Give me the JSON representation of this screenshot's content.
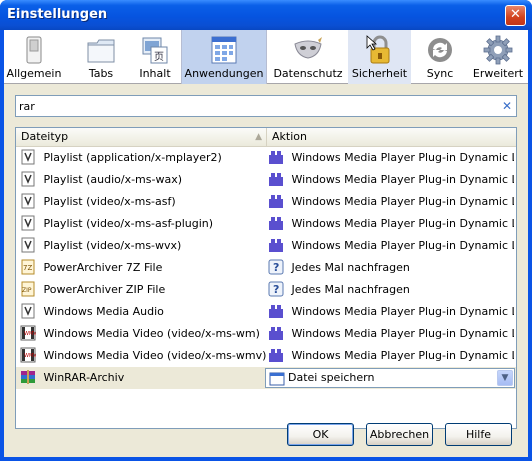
{
  "window": {
    "title": "Einstellungen",
    "close_glyph": "✕"
  },
  "toolbar": {
    "tabs": [
      {
        "label": "Allgemein",
        "icon": "general-switch-icon"
      },
      {
        "label": "Tabs",
        "icon": "tabs-folder-icon"
      },
      {
        "label": "Inhalt",
        "icon": "content-icon"
      },
      {
        "label": "Anwendungen",
        "icon": "applications-icon",
        "selected": true
      },
      {
        "label": "Datenschutz",
        "icon": "privacy-mask-icon"
      },
      {
        "label": "Sicherheit",
        "icon": "security-lock-icon"
      },
      {
        "label": "Sync",
        "icon": "sync-icon"
      },
      {
        "label": "Erweitert",
        "icon": "advanced-gear-icon"
      }
    ]
  },
  "search": {
    "value": "rar",
    "clear_glyph": "✕"
  },
  "table": {
    "headers": {
      "type": "Dateityp",
      "action": "Aktion",
      "sort_glyph": "▲"
    },
    "rows": [
      {
        "type": "Playlist (application/x-mplayer2)",
        "type_icon": "media-file-icon",
        "action": "Windows Media Player Plug-in Dynamic Link ...",
        "action_icon": "plugin-icon"
      },
      {
        "type": "Playlist (audio/x-ms-wax)",
        "type_icon": "media-file-icon",
        "action": "Windows Media Player Plug-in Dynamic Link ...",
        "action_icon": "plugin-icon"
      },
      {
        "type": "Playlist (video/x-ms-asf)",
        "type_icon": "media-file-icon",
        "action": "Windows Media Player Plug-in Dynamic Link ...",
        "action_icon": "plugin-icon"
      },
      {
        "type": "Playlist (video/x-ms-asf-plugin)",
        "type_icon": "media-file-icon",
        "action": "Windows Media Player Plug-in Dynamic Link ...",
        "action_icon": "plugin-icon"
      },
      {
        "type": "Playlist (video/x-ms-wvx)",
        "type_icon": "media-file-icon",
        "action": "Windows Media Player Plug-in Dynamic Link ...",
        "action_icon": "plugin-icon"
      },
      {
        "type": "PowerArchiver 7Z File",
        "type_icon": "archive-7z-icon",
        "action": "Jedes Mal nachfragen",
        "action_icon": "ask-icon"
      },
      {
        "type": "PowerArchiver ZIP File",
        "type_icon": "archive-zip-icon",
        "action": "Jedes Mal nachfragen",
        "action_icon": "ask-icon"
      },
      {
        "type": "Windows Media Audio",
        "type_icon": "media-file-icon",
        "action": "Windows Media Player Plug-in Dynamic Link ...",
        "action_icon": "plugin-icon"
      },
      {
        "type": "Windows Media Video (video/x-ms-wm)",
        "type_icon": "wmv-file-icon",
        "action": "Windows Media Player Plug-in Dynamic Link ...",
        "action_icon": "plugin-icon"
      },
      {
        "type": "Windows Media Video (video/x-ms-wmv)",
        "type_icon": "wmv-file-icon",
        "action": "Windows Media Player Plug-in Dynamic Link ...",
        "action_icon": "plugin-icon"
      },
      {
        "type": "WinRAR-Archiv",
        "type_icon": "winrar-icon",
        "action": "Datei speichern",
        "action_icon": "save-file-icon",
        "selected": true,
        "dropdown_glyph": "▼"
      }
    ]
  },
  "buttons": {
    "ok": "OK",
    "cancel": "Abbrechen",
    "help": "Hilfe"
  }
}
